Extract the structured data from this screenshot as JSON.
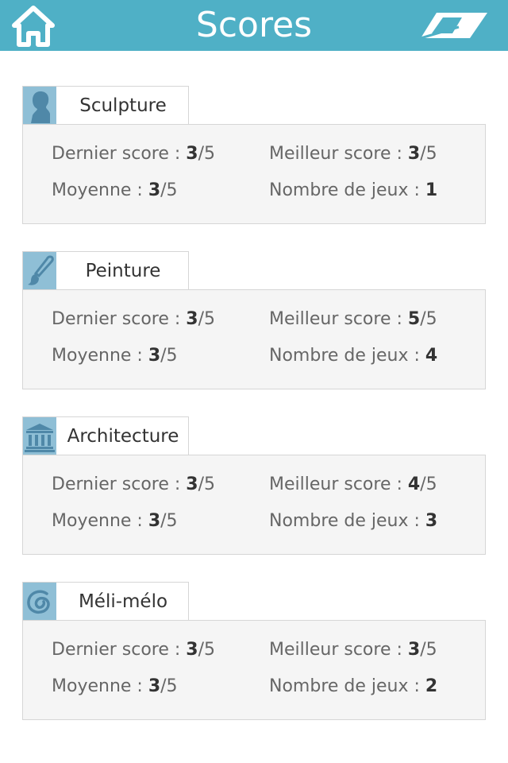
{
  "header": {
    "title": "Scores",
    "home_icon": "home-icon",
    "right_icon": "glasses-icon",
    "background": "#4fb0c6"
  },
  "labels": {
    "last_score": "Dernier score : ",
    "best_score": "Meilleur score : ",
    "average": "Moyenne : ",
    "games_count": "Nombre de jeux : "
  },
  "categories": [
    {
      "name": "Sculpture",
      "icon": "bust-icon",
      "last": "3",
      "best": "3",
      "avg": "3",
      "out_of": "/5",
      "games": "1"
    },
    {
      "name": "Peinture",
      "icon": "paintbrush-icon",
      "last": "3",
      "best": "5",
      "avg": "3",
      "out_of": "/5",
      "games": "4"
    },
    {
      "name": "Architecture",
      "icon": "temple-icon",
      "last": "3",
      "best": "4",
      "avg": "3",
      "out_of": "/5",
      "games": "3"
    },
    {
      "name": "Méli-mélo",
      "icon": "swirl-icon",
      "last": "3",
      "best": "3",
      "avg": "3",
      "out_of": "/5",
      "games": "2"
    }
  ]
}
